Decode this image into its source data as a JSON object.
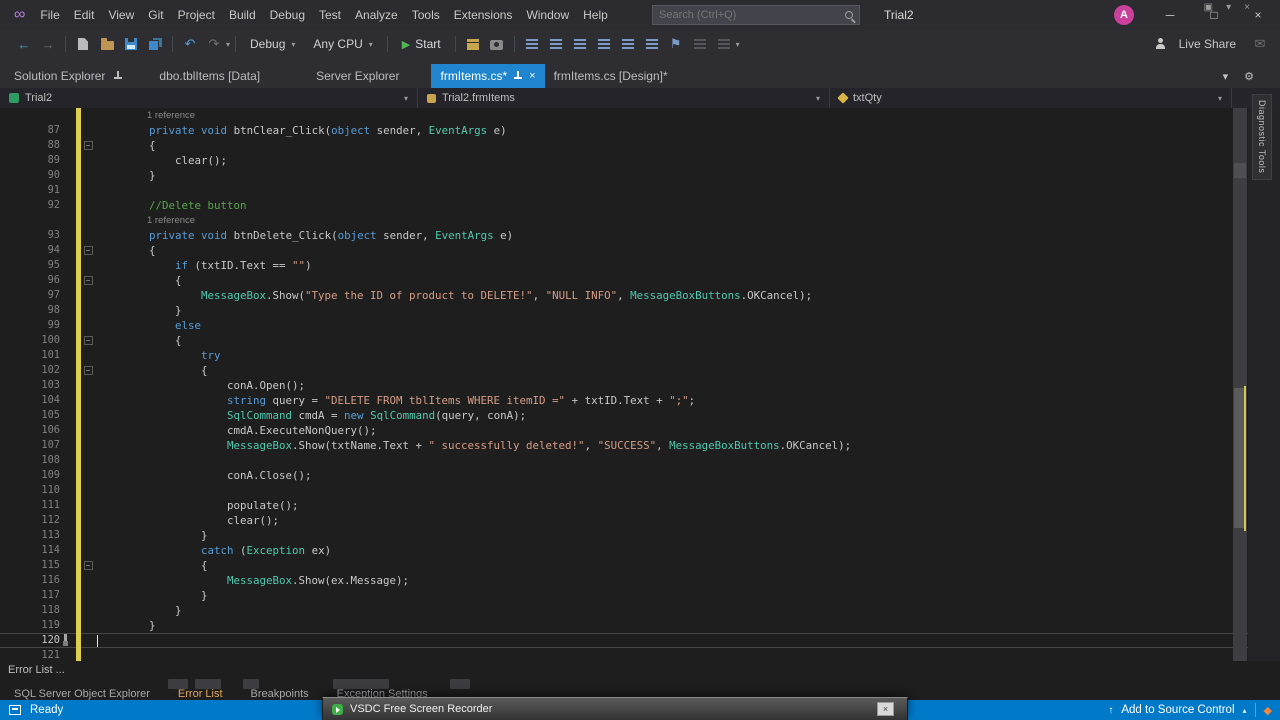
{
  "titlebar": {
    "title": "Trial2",
    "menus": [
      "File",
      "Edit",
      "View",
      "Git",
      "Project",
      "Build",
      "Debug",
      "Test",
      "Analyze",
      "Tools",
      "Extensions",
      "Window",
      "Help"
    ],
    "search_placeholder": "Search (Ctrl+Q)",
    "avatar_letter": "A"
  },
  "toolbar": {
    "config_dropdown": "Debug",
    "platform_dropdown": "Any CPU",
    "start_label": "Start",
    "live_share_label": "Live Share"
  },
  "tabstrip": {
    "tool_tabs": [
      "Solution Explorer",
      "dbo.tblItems [Data]",
      "Server Explorer"
    ],
    "doc_tabs": [
      {
        "label": "frmItems.cs*",
        "active": true
      },
      {
        "label": "frmItems.cs [Design]*",
        "active": false
      }
    ]
  },
  "navbar": {
    "project": "Trial2",
    "type": "Trial2.frmItems",
    "member": "txtQty"
  },
  "right_rail": {
    "diagnostic_tools": "Diagnostic Tools"
  },
  "editor": {
    "cursor_line": "120",
    "rows": [
      {
        "lens": "1 reference"
      },
      {
        "n": "87",
        "t": [
          [
            "p",
            "        "
          ],
          [
            "k",
            "private"
          ],
          [
            "p",
            " "
          ],
          [
            "k",
            "void"
          ],
          [
            "p",
            " btnClear_Click("
          ],
          [
            "k",
            "object"
          ],
          [
            "p",
            " sender, "
          ],
          [
            "t",
            "EventArgs"
          ],
          [
            "p",
            " e)"
          ]
        ]
      },
      {
        "n": "88",
        "t": [
          [
            "p",
            "        {"
          ]
        ],
        "fold": true
      },
      {
        "n": "89",
        "t": [
          [
            "p",
            "            clear();"
          ]
        ]
      },
      {
        "n": "90",
        "t": [
          [
            "p",
            "        }"
          ]
        ]
      },
      {
        "n": "91",
        "t": []
      },
      {
        "n": "92",
        "t": [
          [
            "p",
            "        "
          ],
          [
            "c",
            "//Delete button"
          ]
        ]
      },
      {
        "lens": "1 reference"
      },
      {
        "n": "93",
        "t": [
          [
            "p",
            "        "
          ],
          [
            "k",
            "private"
          ],
          [
            "p",
            " "
          ],
          [
            "k",
            "void"
          ],
          [
            "p",
            " btnDelete_Click("
          ],
          [
            "k",
            "object"
          ],
          [
            "p",
            " sender, "
          ],
          [
            "t",
            "EventArgs"
          ],
          [
            "p",
            " e)"
          ]
        ]
      },
      {
        "n": "94",
        "t": [
          [
            "p",
            "        {"
          ]
        ],
        "fold": true
      },
      {
        "n": "95",
        "t": [
          [
            "p",
            "            "
          ],
          [
            "k",
            "if"
          ],
          [
            "p",
            " (txtID.Text == "
          ],
          [
            "s",
            "\"\""
          ],
          [
            "p",
            ")"
          ]
        ]
      },
      {
        "n": "96",
        "t": [
          [
            "p",
            "            {"
          ]
        ],
        "fold": true
      },
      {
        "n": "97",
        "t": [
          [
            "p",
            "                "
          ],
          [
            "t",
            "MessageBox"
          ],
          [
            "p",
            ".Show("
          ],
          [
            "s",
            "\"Type the ID of product to DELETE!\""
          ],
          [
            "p",
            ", "
          ],
          [
            "s",
            "\"NULL INFO\""
          ],
          [
            "p",
            ", "
          ],
          [
            "t",
            "MessageBoxButtons"
          ],
          [
            "p",
            ".OKCancel);"
          ]
        ]
      },
      {
        "n": "98",
        "t": [
          [
            "p",
            "            }"
          ]
        ]
      },
      {
        "n": "99",
        "t": [
          [
            "p",
            "            "
          ],
          [
            "k",
            "else"
          ]
        ]
      },
      {
        "n": "100",
        "t": [
          [
            "p",
            "            {"
          ]
        ],
        "fold": true
      },
      {
        "n": "101",
        "t": [
          [
            "p",
            "                "
          ],
          [
            "k",
            "try"
          ]
        ]
      },
      {
        "n": "102",
        "t": [
          [
            "p",
            "                {"
          ]
        ],
        "fold": true
      },
      {
        "n": "103",
        "t": [
          [
            "p",
            "                    conA.Open();"
          ]
        ]
      },
      {
        "n": "104",
        "t": [
          [
            "p",
            "                    "
          ],
          [
            "k",
            "string"
          ],
          [
            "p",
            " query = "
          ],
          [
            "s",
            "\"DELETE FROM tblItems WHERE itemID =\""
          ],
          [
            "p",
            " + txtID.Text + "
          ],
          [
            "s",
            "\";\""
          ],
          [
            "p",
            ";"
          ]
        ]
      },
      {
        "n": "105",
        "t": [
          [
            "p",
            "                    "
          ],
          [
            "t",
            "SqlCommand"
          ],
          [
            "p",
            " cmdA = "
          ],
          [
            "k",
            "new"
          ],
          [
            "p",
            " "
          ],
          [
            "t",
            "SqlCommand"
          ],
          [
            "p",
            "(query, conA);"
          ]
        ]
      },
      {
        "n": "106",
        "t": [
          [
            "p",
            "                    cmdA.ExecuteNonQuery();"
          ]
        ]
      },
      {
        "n": "107",
        "t": [
          [
            "p",
            "                    "
          ],
          [
            "t",
            "MessageBox"
          ],
          [
            "p",
            ".Show(txtName.Text + "
          ],
          [
            "s",
            "\" successfully deleted!\""
          ],
          [
            "p",
            ", "
          ],
          [
            "s",
            "\"SUCCESS\""
          ],
          [
            "p",
            ", "
          ],
          [
            "t",
            "MessageBoxButtons"
          ],
          [
            "p",
            ".OKCancel);"
          ]
        ]
      },
      {
        "n": "108",
        "t": []
      },
      {
        "n": "109",
        "t": [
          [
            "p",
            "                    conA.Close();"
          ]
        ]
      },
      {
        "n": "110",
        "t": []
      },
      {
        "n": "111",
        "t": [
          [
            "p",
            "                    populate();"
          ]
        ]
      },
      {
        "n": "112",
        "t": [
          [
            "p",
            "                    clear();"
          ]
        ]
      },
      {
        "n": "113",
        "t": [
          [
            "p",
            "                }"
          ]
        ]
      },
      {
        "n": "114",
        "t": [
          [
            "p",
            "                "
          ],
          [
            "k",
            "catch"
          ],
          [
            "p",
            " ("
          ],
          [
            "t",
            "Exception"
          ],
          [
            "p",
            " ex)"
          ]
        ]
      },
      {
        "n": "115",
        "t": [
          [
            "p",
            "                {"
          ]
        ],
        "fold": true
      },
      {
        "n": "116",
        "t": [
          [
            "p",
            "                    "
          ],
          [
            "t",
            "MessageBox"
          ],
          [
            "p",
            ".Show(ex.Message);"
          ]
        ]
      },
      {
        "n": "117",
        "t": [
          [
            "p",
            "                }"
          ]
        ]
      },
      {
        "n": "118",
        "t": [
          [
            "p",
            "            }"
          ]
        ]
      },
      {
        "n": "119",
        "t": [
          [
            "p",
            "        }"
          ]
        ]
      },
      {
        "n": "120",
        "t": [],
        "cur": true,
        "tool": true
      },
      {
        "n": "121",
        "t": []
      }
    ]
  },
  "panel": {
    "header": "Error List ...",
    "tabs": [
      {
        "label": "SQL Server Object Explorer",
        "active": false
      },
      {
        "label": "Error List",
        "active": true
      },
      {
        "label": "Breakpoints",
        "active": false
      },
      {
        "label": "Exception Settings",
        "active": false
      }
    ]
  },
  "statusbar": {
    "ready": "Ready",
    "source_control": "Add to Source Control"
  },
  "recorder": {
    "title": "VSDC Free Screen Recorder"
  },
  "colors": {
    "accent_tab": "#1E85CE",
    "status_bar": "#0179C9",
    "keyword": "#569CD6",
    "type": "#4EC9B0",
    "string": "#D69D85",
    "comment": "#57A64A",
    "change_bar": "#E0CE4E",
    "avatar": "#C9419A"
  }
}
